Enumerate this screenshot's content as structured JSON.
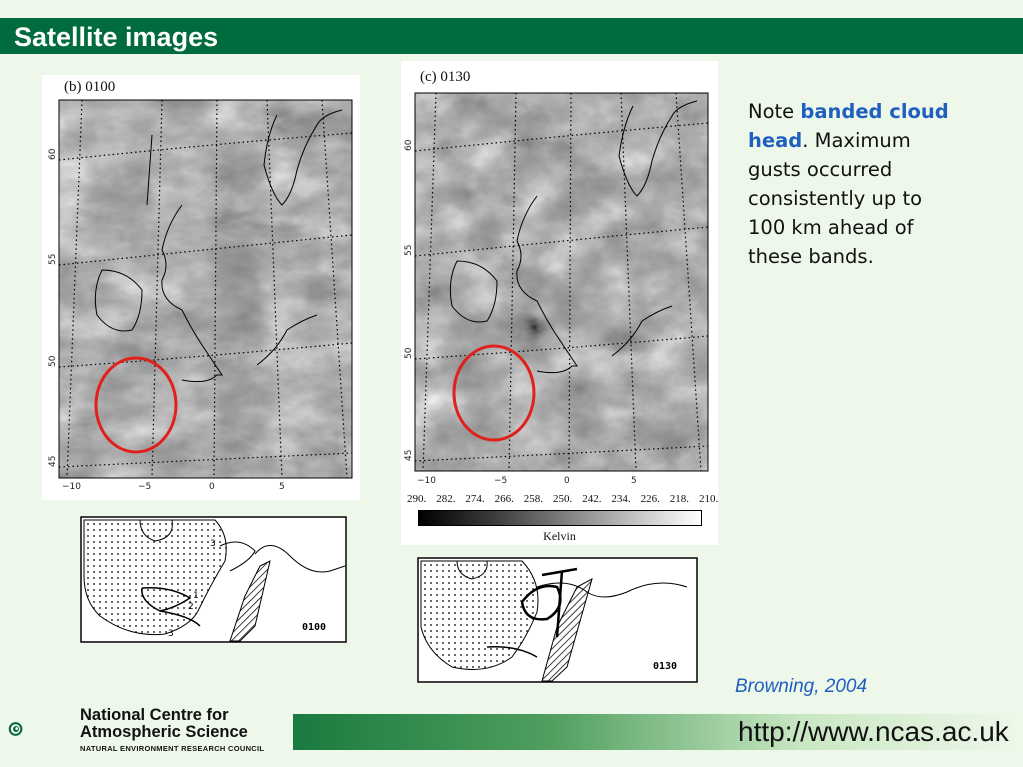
{
  "title": "Satellite images",
  "panel_b": {
    "label": "(b) 0100",
    "lat_ticks": [
      "45",
      "50",
      "55",
      "60"
    ],
    "lon_ticks": [
      "−10",
      "−5",
      "0",
      "5"
    ]
  },
  "panel_c": {
    "label": "(c) 0130",
    "lat_ticks": [
      "45",
      "50",
      "55",
      "60"
    ],
    "lon_ticks": [
      "−10",
      "−5",
      "0",
      "5"
    ]
  },
  "colorbar": {
    "ticks": [
      "290.",
      "282.",
      "274.",
      "266.",
      "258.",
      "250.",
      "242.",
      "234.",
      "226.",
      "218.",
      "210."
    ],
    "unit": "Kelvin"
  },
  "sketch_b": {
    "label": "0100",
    "numbers": [
      "3",
      "2",
      "1",
      "3"
    ]
  },
  "sketch_c": {
    "label": "0130"
  },
  "note": {
    "prefix": "Note ",
    "highlight": "banded cloud head",
    "suffix": ". Maximum gusts occurred consistently up to 100 km ahead of these bands."
  },
  "citation": "Browning, 2004",
  "footer": {
    "url": "http://www.ncas.ac.uk",
    "org_line1": "National Centre for",
    "org_line2": "Atmospheric Science",
    "org_line3": "NATURAL ENVIRONMENT RESEARCH COUNCIL"
  },
  "colors": {
    "header_green": "#006b3c",
    "accent_blue": "#1f5fbf",
    "circle_red": "#e0201a"
  }
}
